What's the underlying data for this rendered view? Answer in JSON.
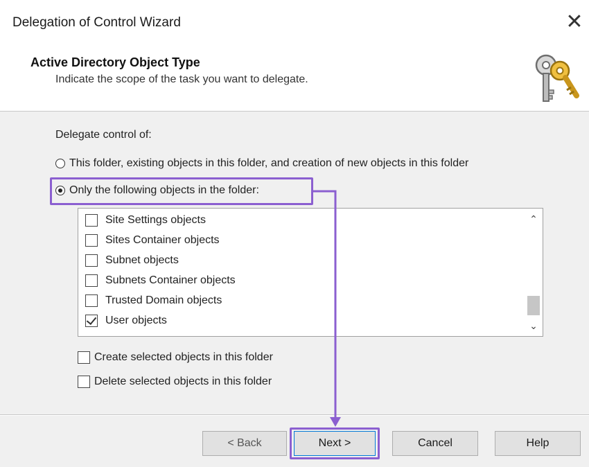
{
  "window": {
    "title": "Delegation of Control Wizard",
    "close_glyph": "✕"
  },
  "header": {
    "title": "Active Directory Object Type",
    "subtitle": "Indicate the scope of the task you want to delegate.",
    "icon": "keys-icon"
  },
  "body": {
    "delegate_label": "Delegate control of:",
    "radio_all": {
      "label": "This folder, existing objects in this folder, and creation of new objects in this folder",
      "checked": false
    },
    "radio_only": {
      "label": "Only the following objects in the folder:",
      "checked": true
    },
    "object_list": [
      {
        "label": "Site Settings objects",
        "checked": false
      },
      {
        "label": "Sites Container objects",
        "checked": false
      },
      {
        "label": "Subnet objects",
        "checked": false
      },
      {
        "label": "Subnets Container objects",
        "checked": false
      },
      {
        "label": "Trusted Domain objects",
        "checked": false
      },
      {
        "label": "User objects",
        "checked": true
      }
    ],
    "scroll_up_glyph": "⌃",
    "scroll_down_glyph": "⌄",
    "create_option": {
      "label": "Create selected objects in this folder",
      "checked": false
    },
    "delete_option": {
      "label": "Delete selected objects in this folder",
      "checked": false
    }
  },
  "buttons": {
    "back": "< Back",
    "next": "Next >",
    "cancel": "Cancel",
    "help": "Help"
  },
  "colors": {
    "highlight": "#8b5fd0",
    "dialog_bg": "#f0f0f0",
    "button_focus": "#0078d7"
  }
}
